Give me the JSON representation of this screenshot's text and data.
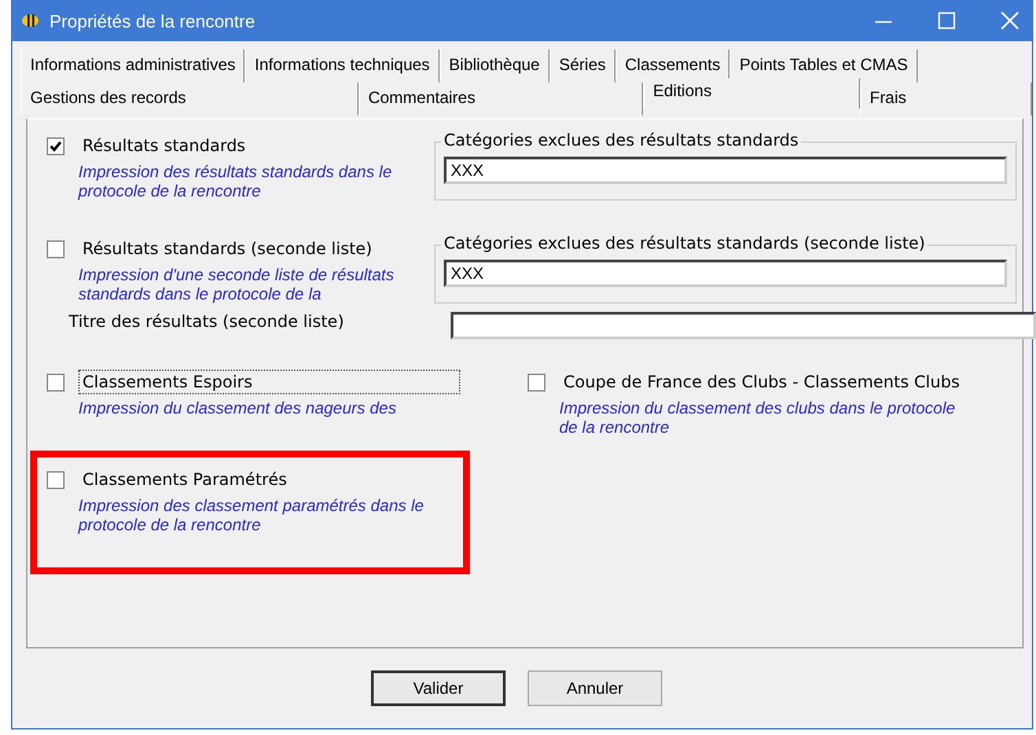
{
  "window": {
    "title": "Propriétés de la rencontre"
  },
  "tab_rows": [
    [
      {
        "label": "Informations administratives",
        "selected": false
      },
      {
        "label": "Informations techniques",
        "selected": false
      },
      {
        "label": "Bibliothèque",
        "selected": false
      },
      {
        "label": "Séries",
        "selected": false
      },
      {
        "label": "Classements",
        "selected": false
      },
      {
        "label": "Points Tables et CMAS",
        "selected": false
      }
    ],
    [
      {
        "label": "Gestions des records",
        "selected": false
      },
      {
        "label": "Commentaires",
        "selected": false
      },
      {
        "label": "Editions",
        "selected": true
      },
      {
        "label": "Frais",
        "selected": false
      }
    ]
  ],
  "field_options": [
    {
      "label": "Résultats standards",
      "checked": true,
      "description": "Impression des résultats standards dans le protocole de la rencontre",
      "group_label": "Catégories exclues des résultats standards",
      "value": "XXX"
    },
    {
      "label": "Résultats standards (seconde liste)",
      "checked": false,
      "description": "Impression d'une seconde liste de résultats standards dans le protocole de la",
      "group_label": "Catégories exclues des résultats standards (seconde liste)",
      "value": "XXX",
      "title_label": "Titre des résultats (seconde liste)"
    }
  ],
  "options": [
    {
      "label": "Classements Espoirs",
      "checked": false,
      "focused": true,
      "description": "Impression du classement des nageurs des"
    },
    {
      "label": "Coupe de France des Clubs - Classements Clubs",
      "checked": false,
      "focused": false,
      "description": "Impression du classement des clubs dans le protocole de la rencontre"
    },
    {
      "label": "Classements Paramétrés",
      "checked": false,
      "focused": false,
      "highlighted": true,
      "description": "Impression des classement paramétrés dans le protocole de la rencontre"
    }
  ],
  "buttons": [
    {
      "label": "Valider",
      "default": true
    },
    {
      "label": "Annuler",
      "default": false
    }
  ]
}
